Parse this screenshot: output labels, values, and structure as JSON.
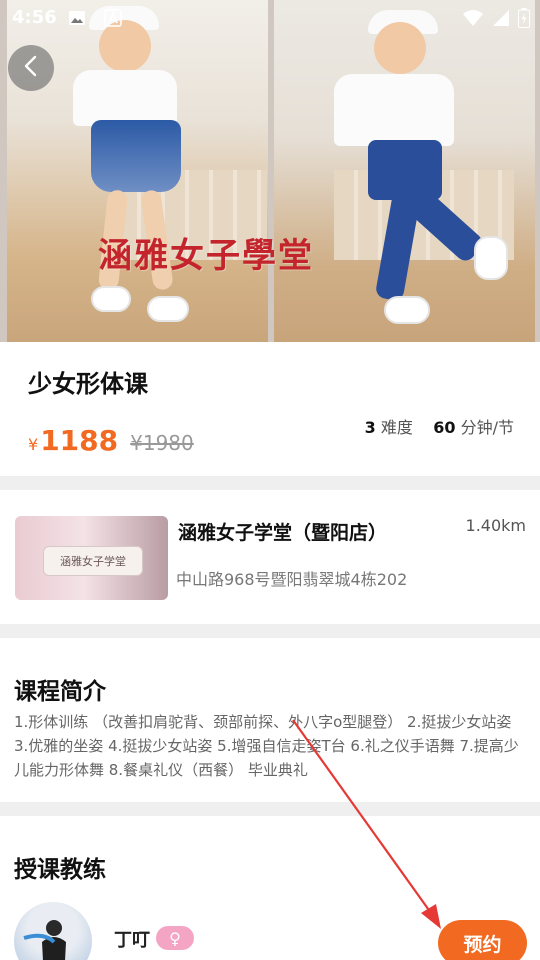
{
  "status_bar": {
    "time": "4:56"
  },
  "hero": {
    "caption": "涵雅女子學堂"
  },
  "course": {
    "title": "少女形体课",
    "currency": "¥",
    "price": "1188",
    "original_price": "¥1980",
    "difficulty_value": "3",
    "difficulty_label": "难度",
    "duration_value": "60",
    "duration_label": "分钟/节"
  },
  "store": {
    "name": "涵雅女子学堂（暨阳店）",
    "distance": "1.40km",
    "address": "中山路968号暨阳翡翠城4栋202",
    "sign_text": "涵雅女子学堂"
  },
  "intro": {
    "title": "课程简介",
    "text": "1.形体训练 （改善扣肩驼背、颈部前探、外八字o型腿登） 2.挺拔少女站姿 3.优雅的坐姿 4.挺拔少女站姿 5.增强自信走姿T台 6.礼之仪手语舞 7.提高少儿能力形体舞 8.餐桌礼仪（西餐） 毕业典礼"
  },
  "coach": {
    "section_title": "授课教练",
    "name": "丁叮",
    "gender_symbol": "♀",
    "book_label": "预约"
  },
  "colors": {
    "accent": "#f26a21",
    "annotation_arrow": "#e53935",
    "gender_badge": "#f4a5c4"
  },
  "icons": [
    "image-icon",
    "font-icon",
    "wifi-icon",
    "signal-icon",
    "battery-icon",
    "back-arrow-icon",
    "female-icon"
  ]
}
